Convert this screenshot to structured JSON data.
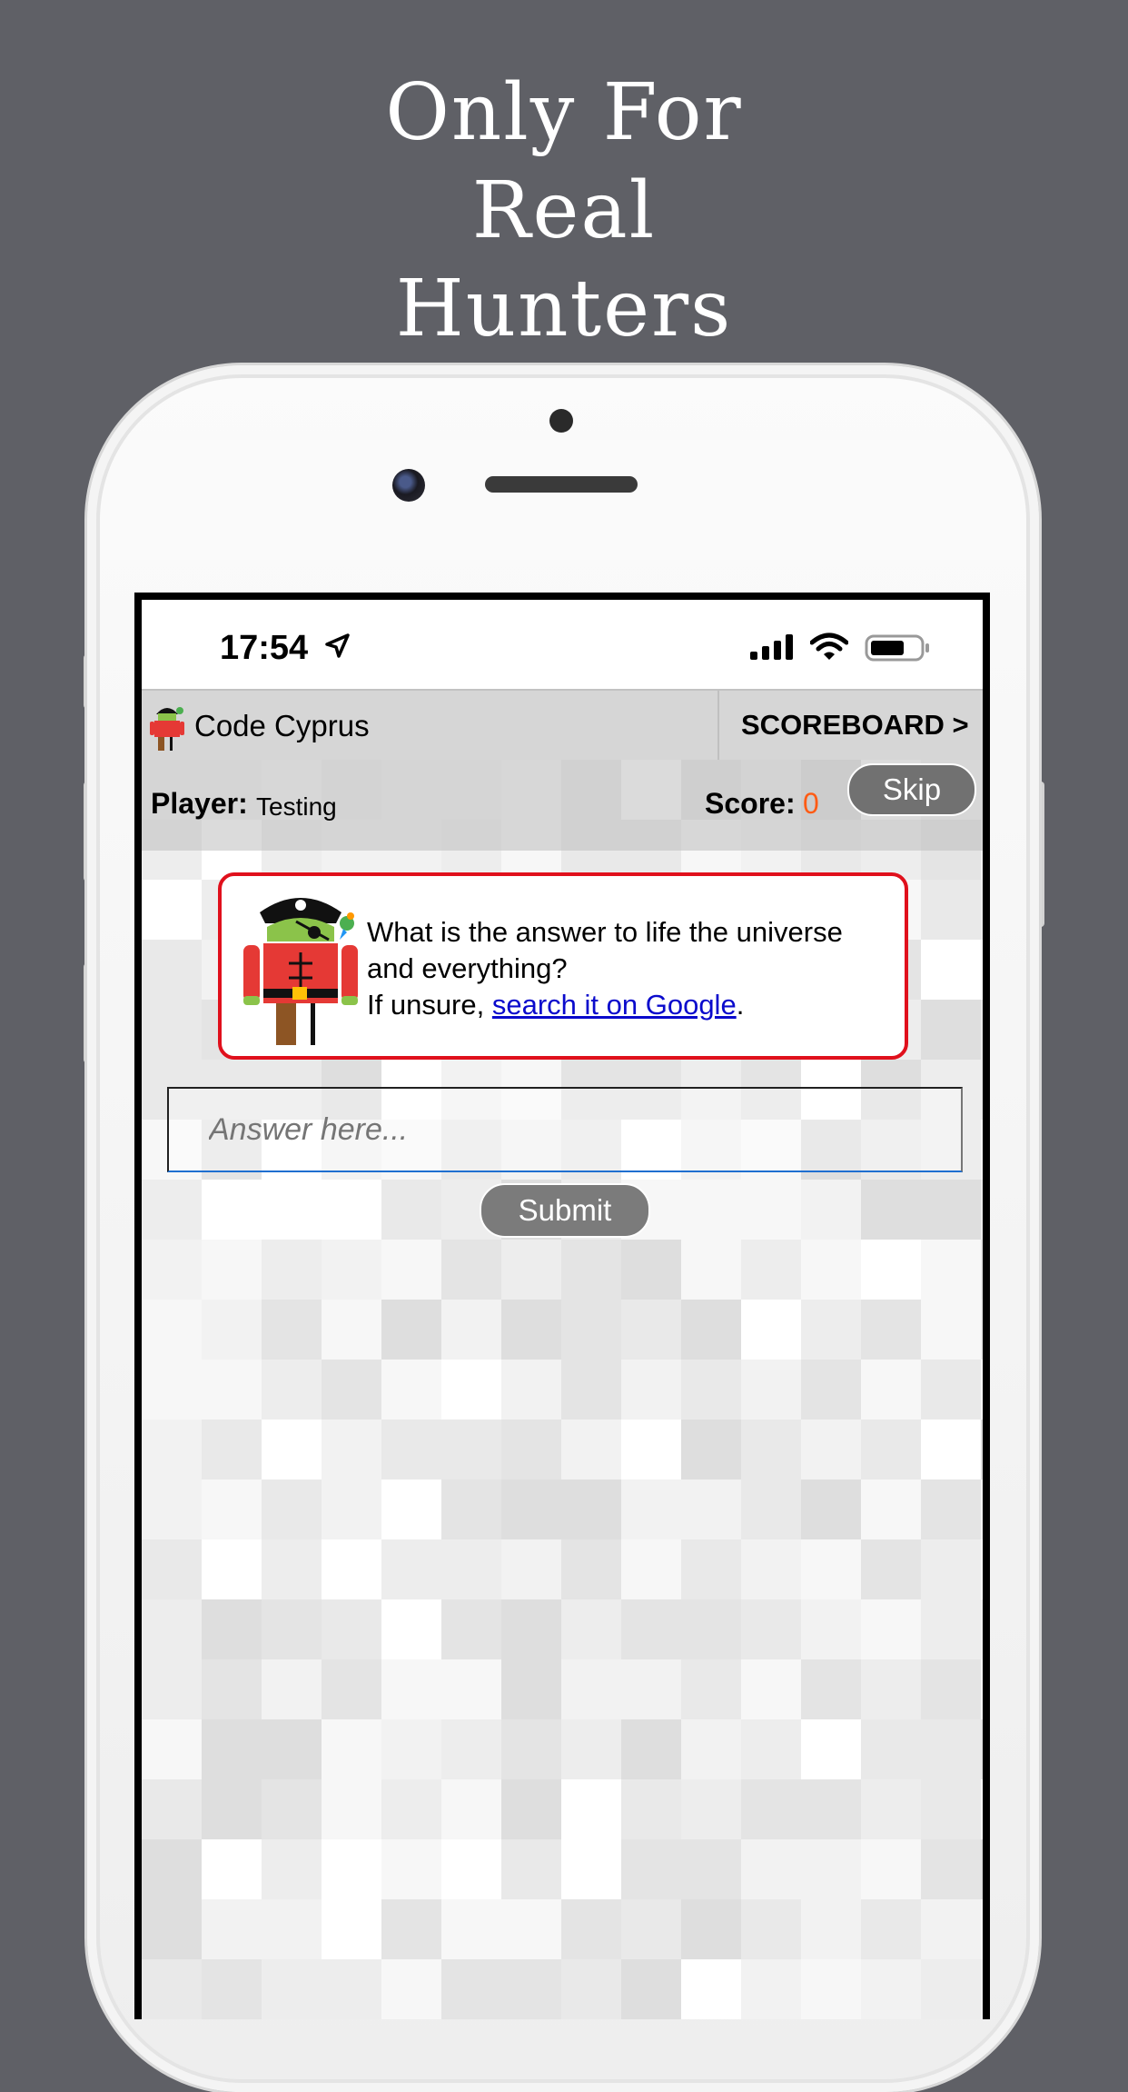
{
  "promo": {
    "headline_lines": [
      "Only For",
      "Real",
      "Hunters"
    ]
  },
  "status_bar": {
    "time": "17:54"
  },
  "navbar": {
    "title": "Code Cyprus",
    "scoreboard_label": "SCOREBOARD >"
  },
  "info": {
    "player_label": "Player:",
    "player_name": "Testing",
    "score_label": "Score:",
    "score_value": "0",
    "skip_label": "Skip"
  },
  "question": {
    "text": "What is the answer to life the universe and everything?",
    "hint_prefix": "If unsure, ",
    "hint_link": "search it on Google",
    "hint_suffix": "."
  },
  "answer": {
    "placeholder": "Answer here..."
  },
  "submit_label": "Submit",
  "colors": {
    "background": "#5f6066",
    "score_accent": "#ff5b14",
    "card_border": "#e0101c",
    "link": "#0a0acc",
    "input_underline": "#1f6fd0"
  },
  "icons": [
    "location-arrow-icon",
    "signal-icon",
    "wifi-icon",
    "battery-icon",
    "pirate-android-icon"
  ]
}
